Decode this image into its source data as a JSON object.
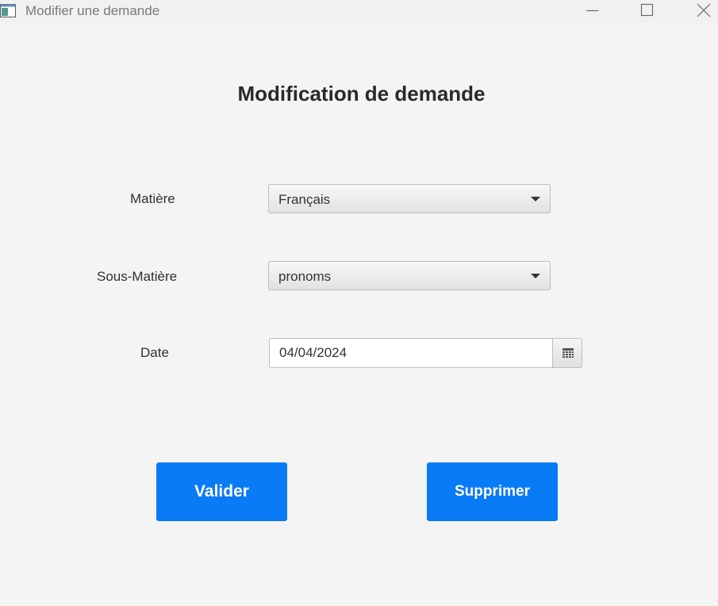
{
  "window": {
    "title": "Modifier une demande",
    "controls": [
      "minimize-icon",
      "maximize-icon",
      "close-icon"
    ]
  },
  "form": {
    "heading": "Modification de demande",
    "matiere": {
      "label": "Matière",
      "value": "Français"
    },
    "sous_matiere": {
      "label": "Sous-Matière",
      "value": "pronoms"
    },
    "date": {
      "label": "Date",
      "value": "04/04/2024",
      "icon": "calendar-icon"
    }
  },
  "actions": {
    "valider": "Valider",
    "supprimer": "Supprimer"
  },
  "colors": {
    "background": "#f4f4f4",
    "accent": "#0a7bf6",
    "button_text": "#ffffff"
  }
}
